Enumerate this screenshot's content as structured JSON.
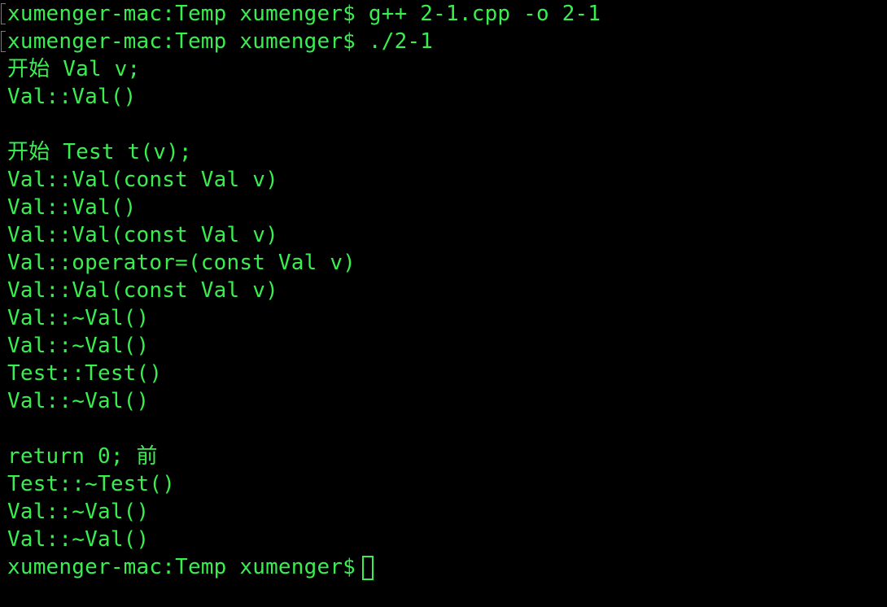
{
  "terminal": {
    "prompt": "xumenger-mac:Temp xumenger$",
    "lines": [
      "xumenger-mac:Temp xumenger$ g++ 2-1.cpp -o 2-1",
      "xumenger-mac:Temp xumenger$ ./2-1",
      "开始 Val v;",
      "Val::Val()",
      "",
      "开始 Test t(v);",
      "Val::Val(const Val v)",
      "Val::Val()",
      "Val::Val(const Val v)",
      "Val::operator=(const Val v)",
      "Val::Val(const Val v)",
      "Val::~Val()",
      "Val::~Val()",
      "Test::Test()",
      "Val::~Val()",
      "",
      "return 0; 前",
      "Test::~Test()",
      "Val::~Val()",
      "Val::~Val()",
      "xumenger-mac:Temp xumenger$"
    ],
    "text_color": "#39ee4f",
    "background_color": "#000000"
  }
}
